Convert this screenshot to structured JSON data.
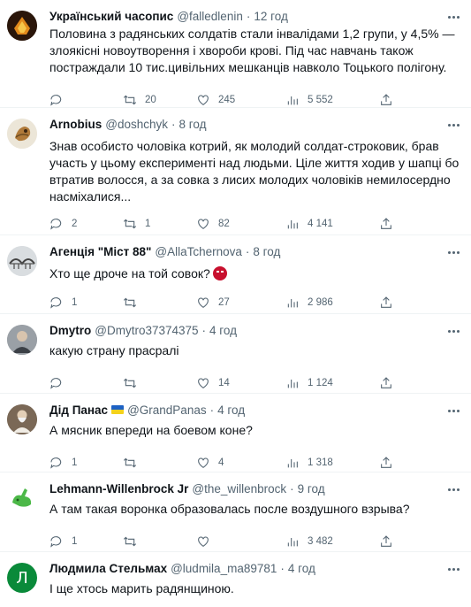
{
  "tweets": [
    {
      "name": "Український часопис",
      "handle": "@falledlenin",
      "time": "12 год",
      "text": "Половина з радянських солдатів стали інвалідами 1,2 групи, у 4,5% — злоякісні новоутворення і хвороби крові. Під час навчань також постраждали 10 тис.цивільних мешканців навколо Тоцького полігону.",
      "replies": "",
      "retweets": "20",
      "likes": "245",
      "views": "5 552"
    },
    {
      "name": "Arnobius",
      "handle": "@doshchyk",
      "time": "8 год",
      "text": "Знав особисто чоловіка котрий, як молодий солдат-строковик, брав участь у цьому експерименті над людьми. Ціле життя ходив у шапці бо втратив волосся, а за совка з лисих молодих чоловіків немилосердно насміхалися...",
      "replies": "2",
      "retweets": "1",
      "likes": "82",
      "views": "4 141"
    },
    {
      "name": "Агенція \"Міст 88\"",
      "handle": "@AllaTchernova",
      "time": "8 год",
      "text": "Хто ще дроче на той совок?",
      "replies": "1",
      "retweets": "",
      "likes": "27",
      "views": "2 986"
    },
    {
      "name": "Dmytro",
      "handle": "@Dmytro37374375",
      "time": "4 год",
      "text": "какую страну прасралі",
      "replies": "",
      "retweets": "",
      "likes": "14",
      "views": "1 124"
    },
    {
      "name": "Дід Панас",
      "handle": "@GrandPanas",
      "time": "4 год",
      "text": "А мясник впереди на боевом коне?",
      "replies": "1",
      "retweets": "",
      "likes": "4",
      "views": "1 318"
    },
    {
      "name": "Lehmann-Willenbrock Jr",
      "handle": "@the_willenbrock",
      "time": "9 год",
      "text": "А там такая воронка образовалась после воздушного взрыва?",
      "replies": "1",
      "retweets": "",
      "likes": "",
      "views": "3 482"
    },
    {
      "name": "Людмила Стельмах",
      "handle": "@ludmila_ma89781",
      "time": "4 год",
      "text": "І ще хтось марить радянщиною.",
      "avatar_letter": "Л"
    }
  ],
  "separator": "·",
  "colors": {
    "text": "#0f1419",
    "muted": "#536471",
    "divider": "#eff3f4",
    "avatar_green": "#0a8a3a"
  },
  "icons": [
    "more-icon",
    "reply-icon",
    "retweet-icon",
    "like-icon",
    "views-icon",
    "share-icon"
  ]
}
